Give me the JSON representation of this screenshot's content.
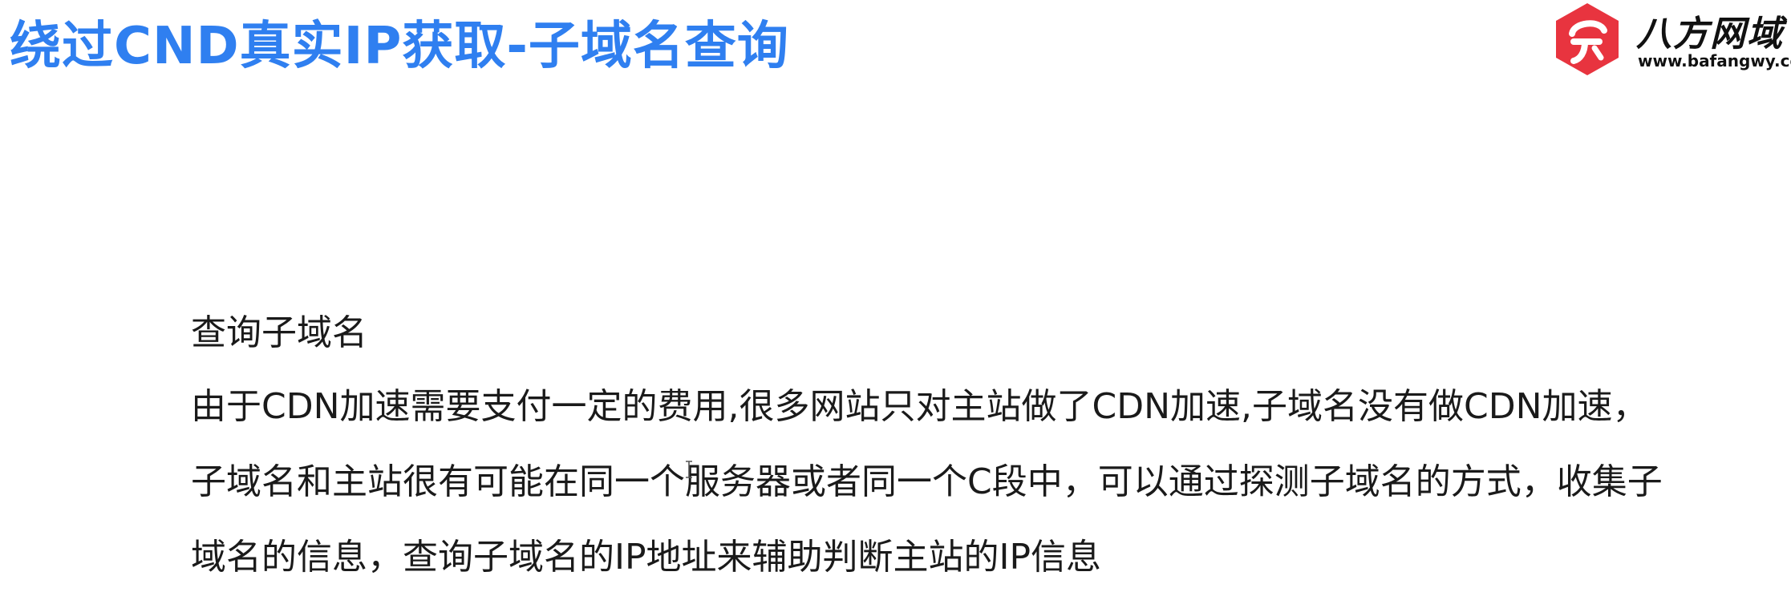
{
  "slide": {
    "title": "绕过CND真实IP获取-子域名查询"
  },
  "logo": {
    "name": "八方网域",
    "url": "www.bafangwy.com",
    "brand_color": "#e8343f",
    "icon": "bafang-logo-icon"
  },
  "content": {
    "heading": "查询子域名",
    "lines": [
      "由于CDN加速需要支付一定的费用,很多网站只对主站做了CDN加速,子域名没有做CDN加速，",
      "子域名和主站很有可能在同一个服务器或者同一个C段中，可以通过探测子域名的方式，收集子",
      "域名的信息，查询子域名的IP地址来辅助判断主站的IP信息"
    ]
  },
  "colors": {
    "title": "#2f7ff0",
    "text": "#1a1a1a",
    "background": "#ffffff"
  }
}
